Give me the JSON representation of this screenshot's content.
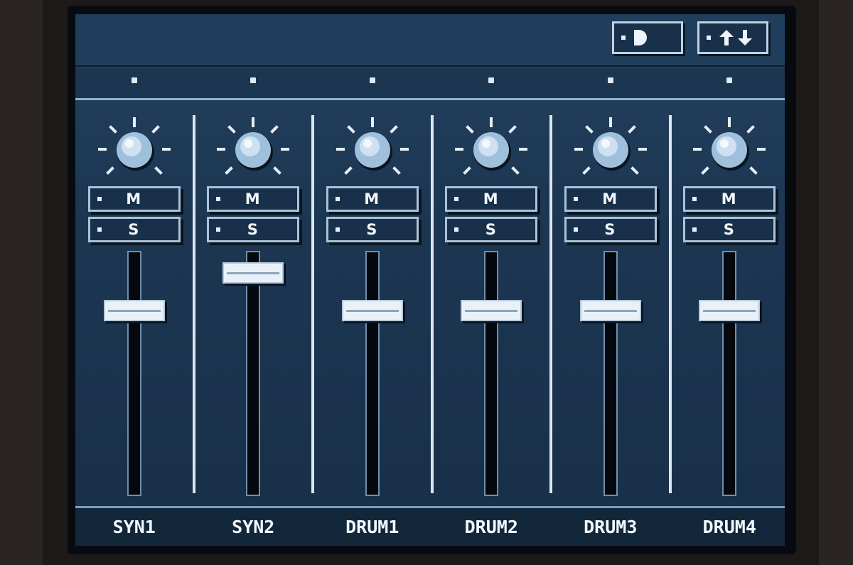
{
  "top": {
    "play_button": {
      "icon": "play-half-icon"
    },
    "updown_button": {
      "icon": "up-down-arrows-icon"
    }
  },
  "colors": {
    "lcd_bg": "#1f3a55",
    "highlight": "#e9f1f8",
    "button_border": "#a9c3da"
  },
  "channels": [
    {
      "name": "SYN1",
      "mute": "M",
      "solo": "S",
      "fader_level": 0.78
    },
    {
      "name": "SYN2",
      "mute": "M",
      "solo": "S",
      "fader_level": 0.95
    },
    {
      "name": "DRUM1",
      "mute": "M",
      "solo": "S",
      "fader_level": 0.78
    },
    {
      "name": "DRUM2",
      "mute": "M",
      "solo": "S",
      "fader_level": 0.78
    },
    {
      "name": "DRUM3",
      "mute": "M",
      "solo": "S",
      "fader_level": 0.78
    },
    {
      "name": "DRUM4",
      "mute": "M",
      "solo": "S",
      "fader_level": 0.78
    }
  ]
}
